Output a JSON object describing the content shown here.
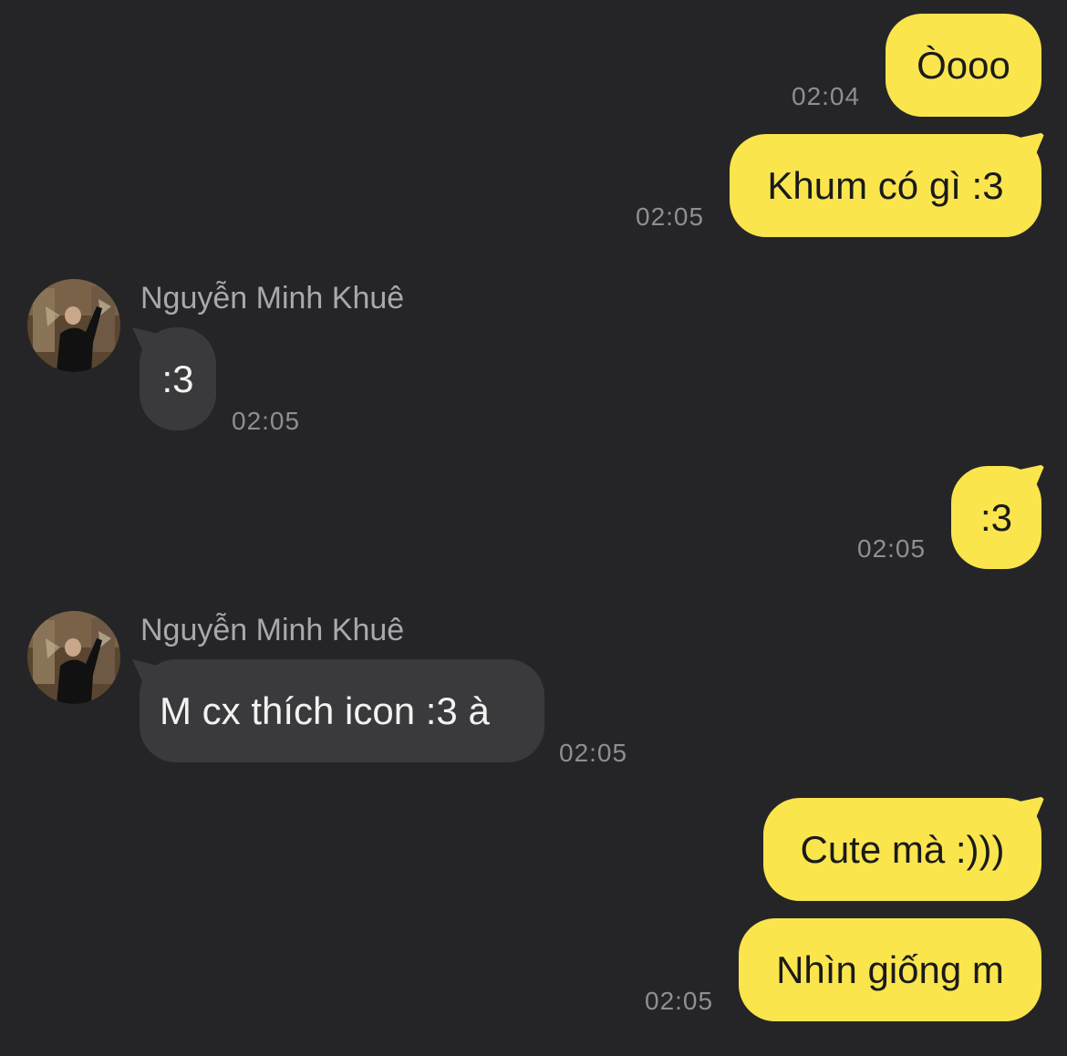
{
  "chat": {
    "messages": [
      {
        "side": "me",
        "text": "Òooo",
        "time": "02:04"
      },
      {
        "side": "me",
        "text": "Khum có gì :3",
        "time": "02:05"
      },
      {
        "side": "other",
        "sender": "Nguyễn Minh Khuê",
        "text": ":3",
        "time": "02:05"
      },
      {
        "side": "me",
        "text": ":3",
        "time": "02:05"
      },
      {
        "side": "other",
        "sender": "Nguyễn Minh Khuê",
        "text": "M cx thích icon :3 à",
        "time": "02:05"
      },
      {
        "side": "me",
        "text": "Cute mà :)))",
        "time": ""
      },
      {
        "side": "me",
        "text": "Nhìn giống m",
        "time": "02:05"
      }
    ]
  },
  "colors": {
    "background": "#252527",
    "my_bubble": "#FAE54D",
    "their_bubble": "#3a3a3c",
    "timestamp": "#8e8e93",
    "sender_name": "#a8a8ad"
  },
  "icons": {
    "avatar": "contact-avatar-photo"
  }
}
